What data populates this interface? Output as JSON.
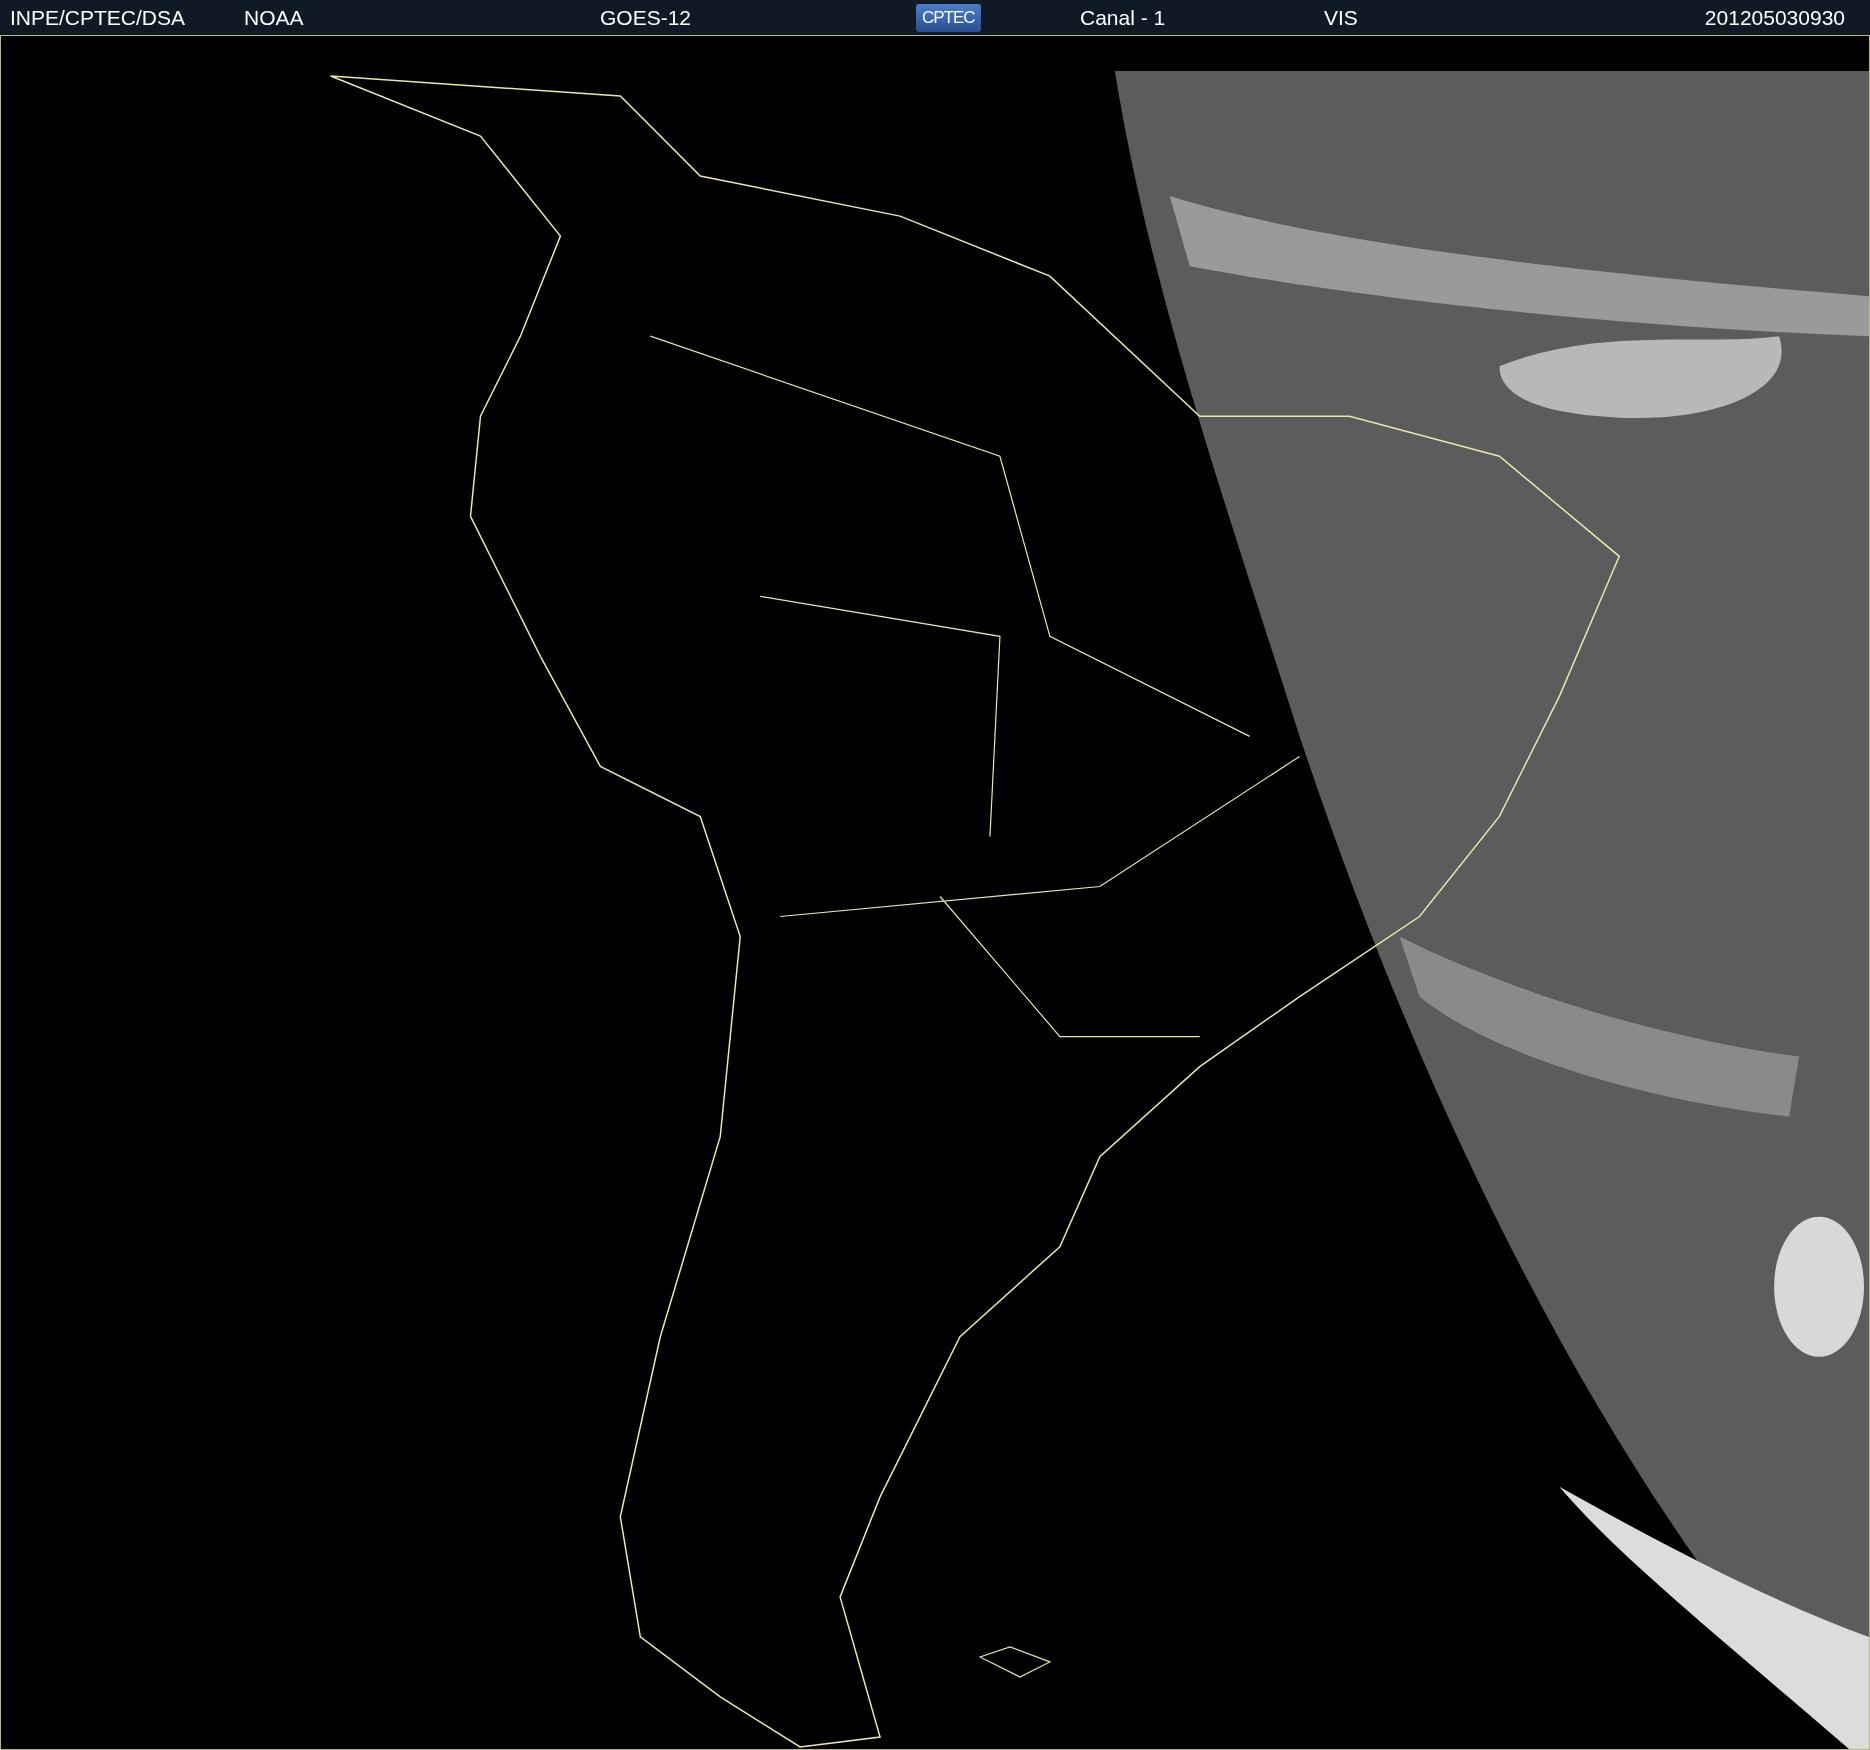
{
  "header": {
    "items": [
      {
        "kind": "text",
        "text": "INPE/CPTEC/DSA"
      },
      {
        "kind": "text",
        "text": "NOAA"
      },
      {
        "kind": "text",
        "text": "GOES-12"
      },
      {
        "kind": "logo",
        "text": "CPTEC"
      },
      {
        "kind": "text",
        "text": "Canal - 1"
      },
      {
        "kind": "text",
        "text": "VIS"
      },
      {
        "kind": "text",
        "text": "201205030930"
      }
    ]
  }
}
